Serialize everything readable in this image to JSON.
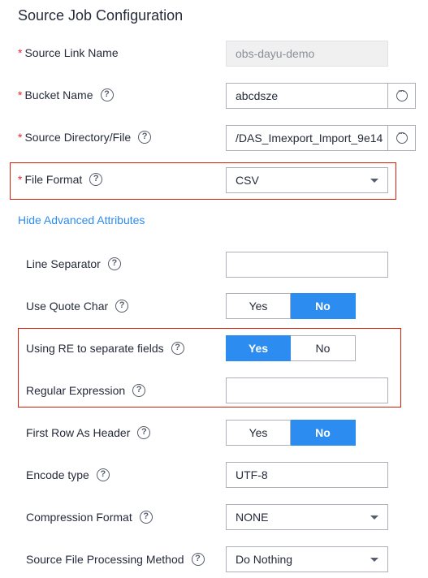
{
  "title": "Source Job Configuration",
  "fields": {
    "source_link_name": {
      "label": "Source Link Name",
      "value": "obs-dayu-demo"
    },
    "bucket_name": {
      "label": "Bucket Name",
      "value": "abcdsze"
    },
    "source_directory": {
      "label": "Source Directory/File",
      "value": "/DAS_Imexport_Import_9e14"
    },
    "file_format": {
      "label": "File Format",
      "value": "CSV"
    },
    "line_separator": {
      "label": "Line Separator",
      "value": ""
    },
    "use_quote_char": {
      "label": "Use Quote Char",
      "yes": "Yes",
      "no": "No",
      "selected": "No"
    },
    "using_re": {
      "label": "Using RE to separate fields",
      "yes": "Yes",
      "no": "No",
      "selected": "Yes"
    },
    "regular_expression": {
      "label": "Regular Expression",
      "value": ""
    },
    "first_row_header": {
      "label": "First Row As Header",
      "yes": "Yes",
      "no": "No",
      "selected": "No"
    },
    "encode_type": {
      "label": "Encode type",
      "value": "UTF-8"
    },
    "compression_format": {
      "label": "Compression Format",
      "value": "NONE"
    },
    "processing_method": {
      "label": "Source File Processing Method",
      "value": "Do Nothing"
    }
  },
  "advanced_link": "Hide Advanced Attributes",
  "required_marker": "*",
  "help_glyph": "?",
  "colors": {
    "accent": "#2d8cf0",
    "required": "#f5222d",
    "highlight_box": "#d81e06"
  }
}
